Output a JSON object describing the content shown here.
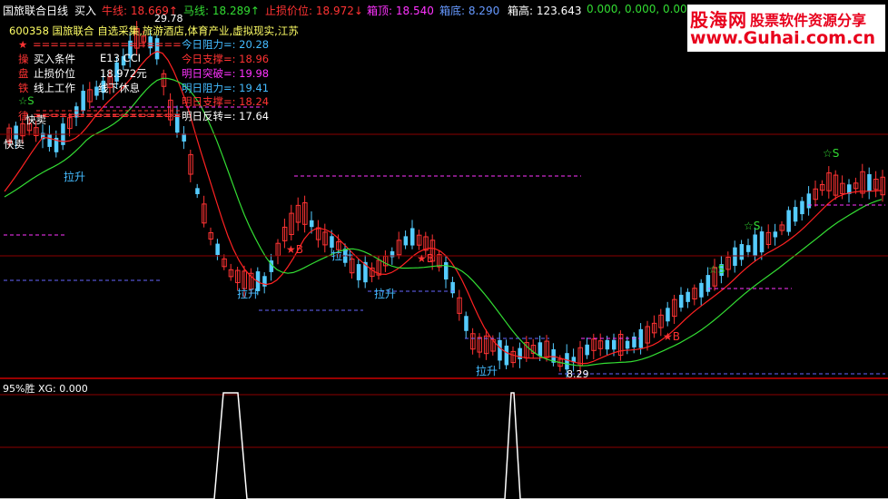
{
  "header": {
    "title": "国旅联合日线",
    "buy": "买入",
    "niuxian": "牛线: 18.669↑",
    "maxian": "马线: 18.289↑",
    "stoploss": "止损价位: 18.972↓",
    "box_top": "箱顶: 18.540",
    "box_bottom": "箱底: 8.290",
    "box_high": "箱高: 123.643",
    "zeros": "0.000, 0.000, 0.000"
  },
  "info": {
    "code_line": "600358 国旅联合 自选采集,旅游酒店,体育产业,虚拟现实,江苏",
    "mark_star": "★",
    "separator": "=================",
    "label_cao": "操",
    "label_pan": "盘",
    "label_tie": "铁",
    "label_lv": "律",
    "buy_cond": "买入条件",
    "cci": "E13 CCI",
    "stop_price": "止损价位",
    "stop_value": "18.972元",
    "line_work": "线上工作",
    "line_rest": "线下休息",
    "zero_s": "☆S",
    "kuaimai": "快卖"
  },
  "levels": {
    "today_res": "今日阻力=: 20.28",
    "today_sup": "今日支撑=: 18.96",
    "tomorrow_break": "明日突破=: 19.98",
    "tomorrow_res": "明日阻力=: 19.41",
    "tomorrow_sup": "明日支撑=: 18.24",
    "tomorrow_rev": "明日反转=: 17.64"
  },
  "annotations": {
    "peak": "29.78",
    "low": "8.29",
    "lasheng": "拉升",
    "star_b": "★B",
    "star_s": "☆S",
    "kuaimai": "快卖"
  },
  "subchart": {
    "label": "95%胜 XG: 0.000"
  },
  "watermark": {
    "brand": "股海网",
    "slogan": "股票软件资源分享",
    "url": "www.Guhai.com.cn"
  },
  "colors": {
    "up": "#ff3333",
    "down": "#55ccff",
    "ma_red": "#ff2222",
    "ma_green": "#33dd33",
    "pink": "#ff33ff",
    "blue": "#6666ff",
    "yellow": "#ffff66",
    "cyan": "#44bbff"
  }
}
